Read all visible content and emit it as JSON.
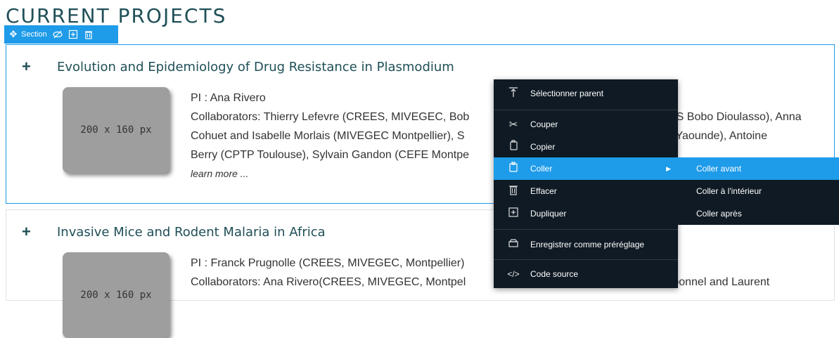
{
  "page": {
    "title": "CURRENT PROJECTS"
  },
  "toolbar": {
    "section_label": "Section"
  },
  "projects": [
    {
      "title": "Evolution and Epidemiology of Drug Resistance in Plasmodium",
      "image_placeholder": "200 x 160 px",
      "lines": [
        "PI : Ana Rivero",
        "Collaborators: Thierry Lefevre (CREES, MIVEGEC, Bob",
        "Cohuet and Isabelle Morlais (MIVEGEC Montpellier), S",
        "Berry (CPTP Toulouse), Sylvain Gandon (CEFE Montpe"
      ],
      "lines_right": [
        "SS Bobo Dioulasso), Anna",
        "r Yaounde), Antoine"
      ],
      "learn_more": "learn more ..."
    },
    {
      "title": "Invasive Mice and Rodent Malaria in Africa",
      "image_placeholder": "200 x 160 px",
      "lines": [
        "PI : Franck Prugnolle (CREES, MIVEGEC, Montpellier)",
        "Collaborators: Ana Rivero(CREES, MIVEGEC, Montpel"
      ],
      "lines_right": [
        "rbonnel and Laurent"
      ]
    }
  ],
  "context_menu": {
    "items": [
      {
        "label": "Sélectionner parent",
        "icon": "select-parent-icon"
      },
      {
        "label": "Couper",
        "icon": "scissors-icon"
      },
      {
        "label": "Copier",
        "icon": "copy-icon"
      },
      {
        "label": "Coller",
        "icon": "paste-icon",
        "active": true
      },
      {
        "label": "Effacer",
        "icon": "trash-icon"
      },
      {
        "label": "Dupliquer",
        "icon": "duplicate-icon"
      },
      {
        "label": "Enregistrer comme préréglage",
        "icon": "save-preset-icon"
      },
      {
        "label": "Code source",
        "icon": "code-icon"
      }
    ]
  },
  "submenu": {
    "items": [
      {
        "label": "Coller avant",
        "active": true
      },
      {
        "label": "Coller à l'intérieur"
      },
      {
        "label": "Coller après"
      }
    ]
  },
  "colors": {
    "accent": "#1e9be9",
    "menu_bg": "#0f1a24",
    "title_color": "#1f4f57"
  }
}
